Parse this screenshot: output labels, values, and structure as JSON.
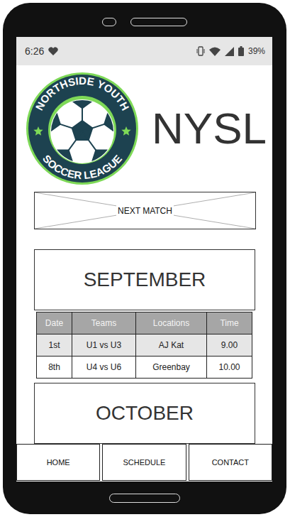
{
  "status_bar": {
    "time": "6:26",
    "battery": "39%"
  },
  "logo": {
    "top_text": "NORTHSIDE YOUTH",
    "bottom_text": "SOCCER LEAGUE"
  },
  "title": "NYSL",
  "next_match": {
    "label": "NEXT MATCH"
  },
  "schedule": {
    "columns": [
      "Date",
      "Teams",
      "Locations",
      "Time"
    ],
    "months": [
      {
        "name": "SEPTEMBER",
        "rows": [
          [
            "1st",
            "U1 vs U3",
            "AJ Kat",
            "9.00"
          ],
          [
            "8th",
            "U4 vs U6",
            "Greenbay",
            "10.00"
          ]
        ]
      },
      {
        "name": "OCTOBER",
        "rows": []
      }
    ]
  },
  "nav": [
    {
      "label": "HOME"
    },
    {
      "label": "SCHEDULE"
    },
    {
      "label": "CONTACT"
    }
  ]
}
